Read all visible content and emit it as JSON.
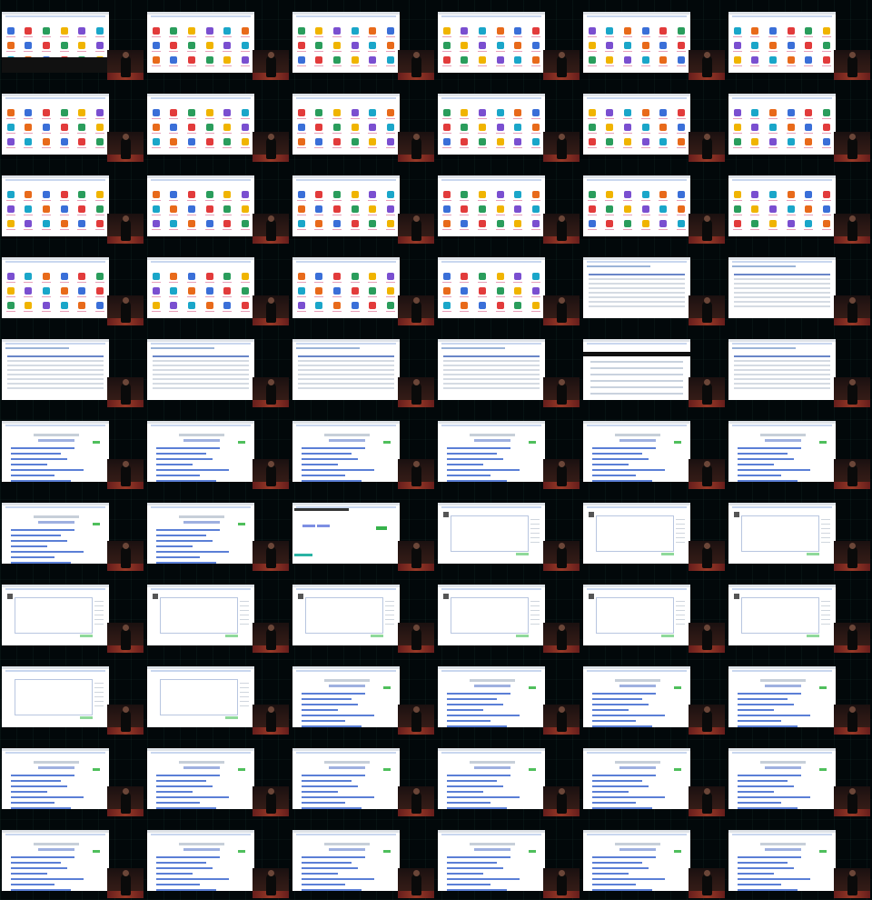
{
  "contact_sheet": {
    "columns": 6,
    "rows": 11,
    "frames": [
      "icon-grid-footer",
      "icon-grid",
      "icon-grid",
      "icon-grid",
      "icon-grid",
      "icon-grid",
      "icon-grid",
      "icon-grid",
      "icon-grid",
      "icon-grid",
      "icon-grid",
      "icon-grid",
      "icon-grid",
      "icon-grid",
      "icon-grid",
      "icon-grid",
      "icon-grid",
      "icon-grid",
      "icon-grid",
      "icon-grid",
      "icon-grid",
      "icon-grid",
      "table",
      "table",
      "table",
      "table",
      "table",
      "table",
      "nav",
      "table",
      "bar-list",
      "bar-list",
      "bar-list",
      "bar-list",
      "bar-list",
      "bar-list",
      "bar-list",
      "bar-list",
      "form",
      "editor",
      "editor",
      "editor",
      "editor",
      "editor",
      "editor",
      "editor",
      "editor",
      "editor",
      "editor-small",
      "editor-small",
      "bar-list",
      "bar-list",
      "bar-list",
      "bar-list",
      "bar-list",
      "bar-list",
      "bar-list",
      "bar-list",
      "bar-list",
      "bar-list",
      "bar-list",
      "bar-list",
      "bar-list",
      "bar-list",
      "bar-list",
      "bar-list"
    ]
  },
  "colors": {
    "background": "#000000",
    "screen": "#ffffff",
    "accent_blue": "#5b7fd6",
    "accent_green": "#4fbf5c",
    "accent_pink": "#e8a0b8"
  }
}
